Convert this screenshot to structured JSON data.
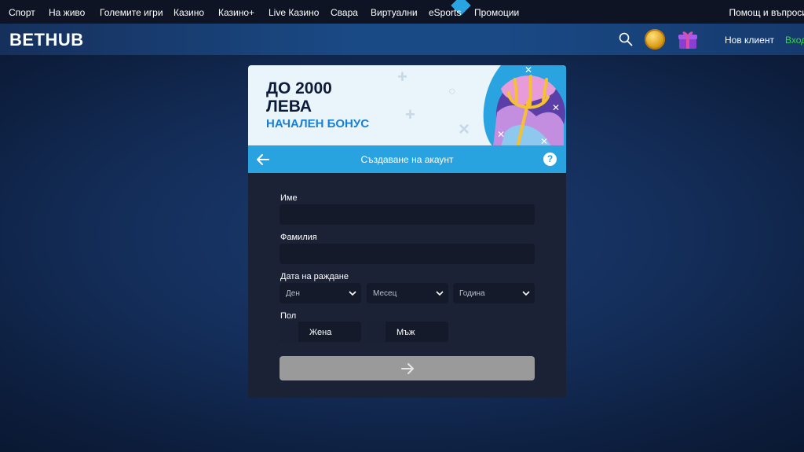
{
  "topnav": {
    "items": [
      "Спорт",
      "На живо",
      "Големите игри",
      "Казино",
      "Казино+",
      "Live Казино",
      "Свара",
      "Виртуални",
      "eSports",
      "Промоции"
    ],
    "help": "Помощ и въпроси"
  },
  "header": {
    "logo": "BETHUB",
    "new_client": "Нов клиент",
    "login": "Вход"
  },
  "banner": {
    "line1": "ДО 2000",
    "line2": "ЛЕВА",
    "sub": "НАЧАЛЕН БОНУС"
  },
  "form": {
    "title": "Създаване на акаунт",
    "help": "?",
    "first_name_label": "Име",
    "first_name_value": "",
    "last_name_label": "Фамилия",
    "last_name_value": "",
    "dob_label": "Дата на раждане",
    "day_placeholder": "Ден",
    "month_placeholder": "Месец",
    "year_placeholder": "Година",
    "gender_label": "Пол",
    "female": "Жена",
    "male": "Мъж"
  },
  "colors": {
    "accent": "#29a3e0",
    "login": "#3fd34a",
    "card": "#1c2236",
    "field": "#141a2a",
    "submit_disabled": "#9a9a9a"
  },
  "icons": {
    "search": "search-icon",
    "coin": "coin-icon",
    "gift": "gift-icon",
    "back": "arrow-left-icon",
    "help": "question-icon",
    "chevron": "chevron-down-icon",
    "submit": "arrow-right-icon"
  }
}
